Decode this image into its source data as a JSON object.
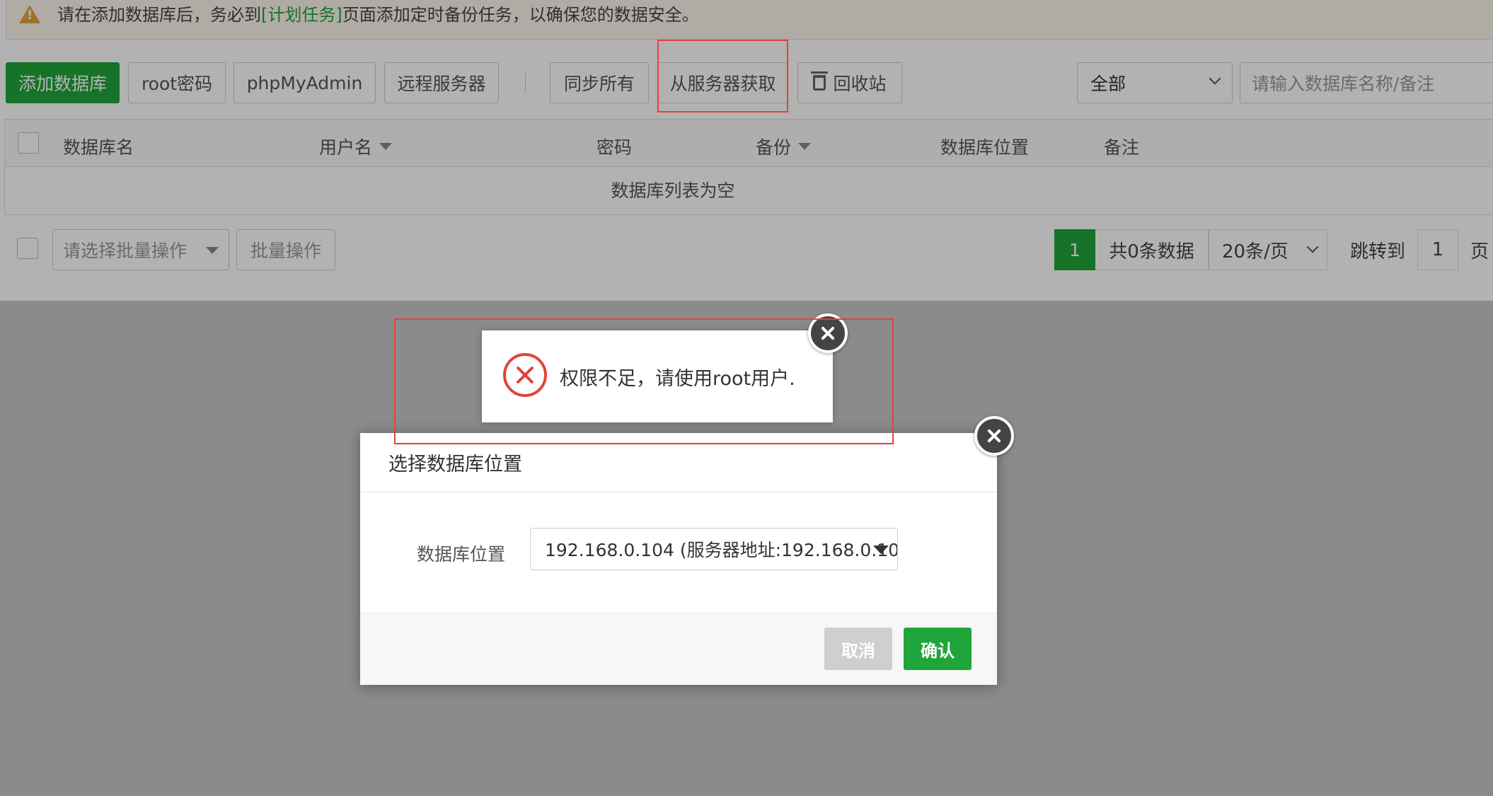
{
  "notice": {
    "prefix": "请在添加数据库后，务必到",
    "link": "[计划任务]",
    "suffix": "页面添加定时备份任务，以确保您的数据安全。"
  },
  "toolbar": {
    "add_database": "添加数据库",
    "root_password": "root密码",
    "phpmyadmin": "phpMyAdmin",
    "remote_server": "远程服务器",
    "sync_all": "同步所有",
    "fetch_from_server": "从服务器获取",
    "recycle_bin": "回收站",
    "filter_selected": "全部",
    "search_placeholder": "请输入数据库名称/备注"
  },
  "table": {
    "columns": [
      "数据库名",
      "用户名",
      "密码",
      "备份",
      "数据库位置",
      "备注"
    ],
    "empty_text": "数据库列表为空"
  },
  "footer": {
    "batch_placeholder": "请选择批量操作",
    "batch_button": "批量操作",
    "current_page": "1",
    "total": "共0条数据",
    "per_page": "20条/页",
    "jump_label": "跳转到",
    "jump_value": "1",
    "page_suffix": "页"
  },
  "toast": {
    "message": "权限不足，请使用root用户."
  },
  "dialog": {
    "title": "选择数据库位置",
    "field_label": "数据库位置",
    "field_value": "192.168.0.104 (服务器地址:192.168.0.10...",
    "cancel": "取消",
    "confirm": "确认"
  },
  "colors": {
    "primary": "#20a53a",
    "error": "#e0443a",
    "highlight": "#e0443a"
  }
}
